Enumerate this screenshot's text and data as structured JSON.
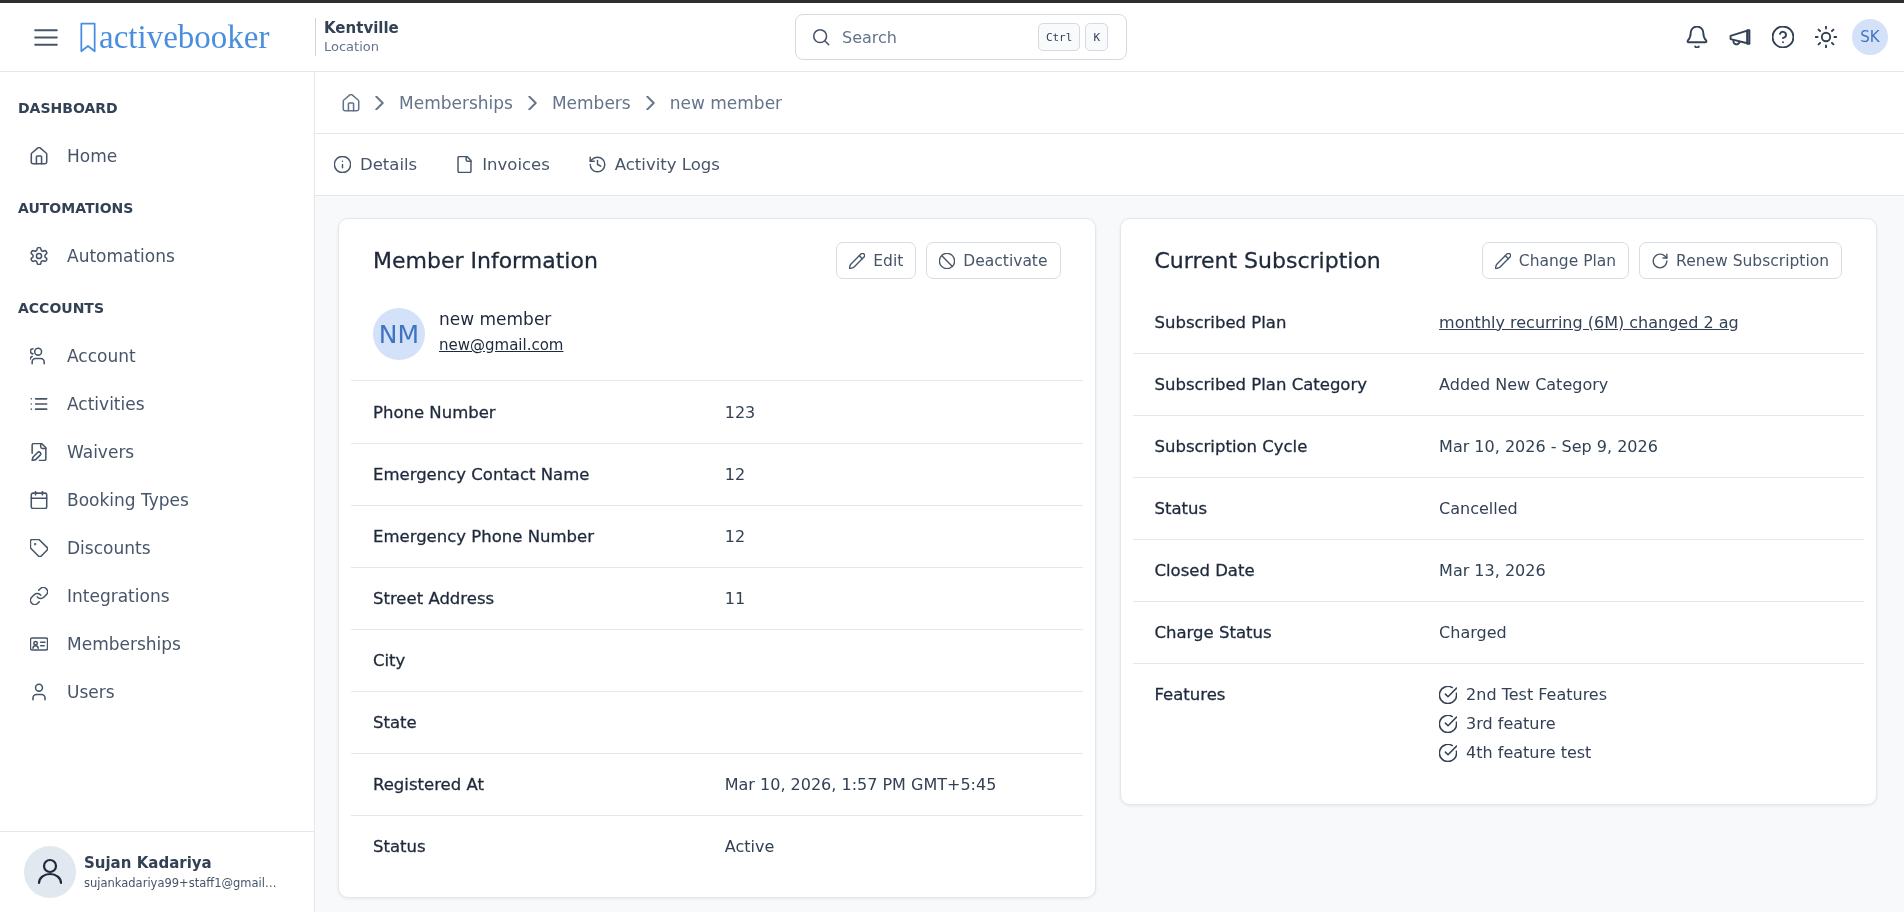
{
  "header": {
    "logo": "activebooker",
    "location": {
      "name": "Kentville",
      "caption": "Location"
    },
    "search": {
      "placeholder": "Search",
      "shortcut_keys": [
        "Ctrl",
        "K"
      ]
    },
    "user_initials": "SK"
  },
  "sidebar": {
    "sections": [
      {
        "title": "DASHBOARD",
        "items": [
          {
            "label": "Home",
            "selected": false
          }
        ]
      },
      {
        "title": "AUTOMATIONS",
        "items": [
          {
            "label": "Automations",
            "selected": false
          }
        ]
      },
      {
        "title": "ACCOUNTS",
        "items": [
          {
            "label": "Account",
            "selected": false
          },
          {
            "label": "Activities",
            "selected": false
          },
          {
            "label": "Waivers",
            "selected": false
          },
          {
            "label": "Booking Types",
            "selected": false
          },
          {
            "label": "Discounts",
            "selected": false
          },
          {
            "label": "Integrations",
            "selected": false
          },
          {
            "label": "Memberships",
            "selected": false
          },
          {
            "label": "Users",
            "selected": false
          }
        ]
      }
    ],
    "user": {
      "name": "Sujan Kadariya",
      "email": "sujankadariya99+staff1@gmail…"
    }
  },
  "breadcrumb": [
    "Memberships",
    "Members",
    "new member"
  ],
  "tabs": [
    {
      "label": "Details",
      "selected": false
    },
    {
      "label": "Invoices",
      "selected": false
    },
    {
      "label": "Activity Logs",
      "selected": false
    }
  ],
  "member_information": {
    "title": "Member Information",
    "actions": [
      "Edit",
      "Deactivate"
    ],
    "initials": "NM",
    "name": "new member",
    "email": "new@gmail.com",
    "fields": [
      {
        "label": "Phone Number",
        "value": "123"
      },
      {
        "label": "Emergency Contact Name",
        "value": "12"
      },
      {
        "label": "Emergency Phone Number",
        "value": "12"
      },
      {
        "label": "Street Address",
        "value": "11"
      },
      {
        "label": "City"
      },
      {
        "label": "State"
      },
      {
        "label": "Registered At",
        "value": "Mar 10, 2026, 1:57 PM GMT+5:45"
      },
      {
        "label": "Status",
        "value": "Active"
      }
    ]
  },
  "current_subscription": {
    "title": "Current Subscription",
    "actions": [
      "Change Plan",
      "Renew Subscription"
    ],
    "fields": [
      {
        "kind": "link",
        "label": "Subscribed Plan",
        "value": "monthly recurring (6M) changed 2 ag"
      },
      {
        "kind": "text",
        "label": "Subscribed Plan Category",
        "value": "Added New Category"
      },
      {
        "kind": "text",
        "label": "Subscription Cycle",
        "value": "Mar 10, 2026 - Sep 9, 2026"
      },
      {
        "kind": "text",
        "label": "Status",
        "value": "Cancelled"
      },
      {
        "kind": "text",
        "label": "Closed Date",
        "value": "Mar 13, 2026"
      },
      {
        "kind": "text",
        "label": "Charge Status",
        "value": "Charged"
      },
      {
        "kind": "checklist",
        "label": "Features",
        "items": [
          "2nd Test Features",
          "3rd feature",
          "4th feature test"
        ]
      }
    ]
  }
}
